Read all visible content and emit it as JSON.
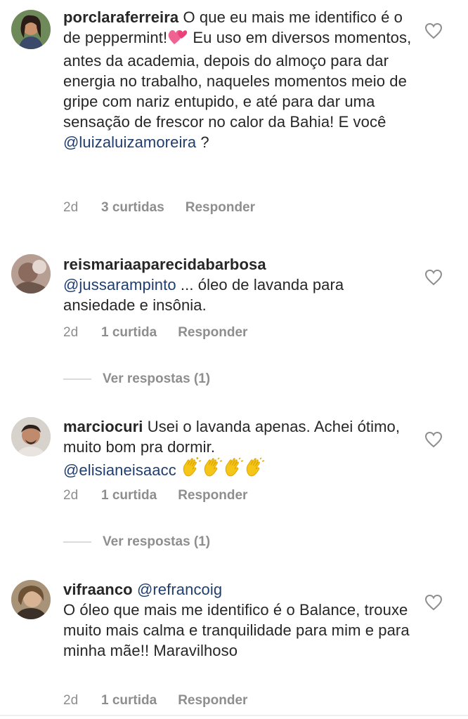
{
  "comments": [
    {
      "username": "porclaraferreira",
      "text_1": "O que eu mais me identifico é o de peppermint!",
      "text_2": " Eu uso em diversos momentos, antes da academia, depois do almoço para dar energia no trabalho, naqueles momentos meio de gripe com nariz entupido, e até para dar uma sensação de frescor no calor da Bahia! E você ",
      "mention": "@luizaluizamoreira",
      "text_3": " ?",
      "time": "2d",
      "likes": "3 curtidas",
      "reply": "Responder",
      "emoji": "two-hearts"
    },
    {
      "username": "reismariaaparecidabarbosa",
      "mention": "@jussarampinto",
      "text_1": " ... óleo de lavanda para ansiedade e insônia.",
      "time": "2d",
      "likes": "1 curtida",
      "reply": "Responder",
      "view_replies": "Ver respostas (1)"
    },
    {
      "username": "marciocuri",
      "text_1": "Usei o lavanda apenas. Achei ótimo, muito bom pra dormir.",
      "mention": "@elisianeisaacc",
      "emoji": "clapping-hands x4",
      "time": "2d",
      "likes": "1 curtida",
      "reply": "Responder",
      "view_replies": "Ver respostas (1)"
    },
    {
      "username": "vifraanco",
      "mention": "@refrancoig",
      "text_1": "O óleo que mais me identifico é o Balance, trouxe muito mais calma e tranquilidade para mim e para minha mãe!! Maravilhoso",
      "time": "2d",
      "likes": "1 curtida",
      "reply": "Responder"
    }
  ],
  "colors": {
    "text": "#262626",
    "muted": "#8e8e8e",
    "mention": "#1f3d6e"
  }
}
